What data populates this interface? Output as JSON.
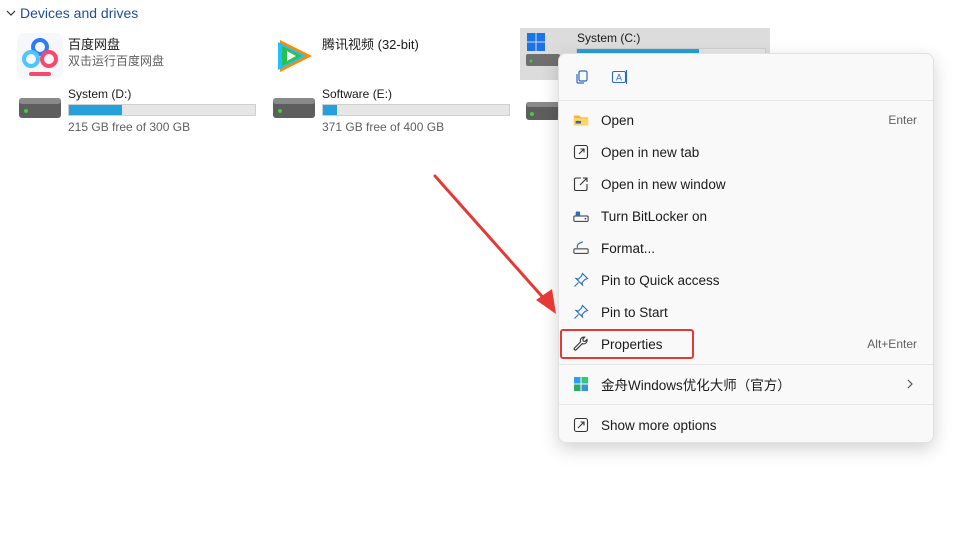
{
  "section": {
    "title": "Devices and drives"
  },
  "tiles": [
    {
      "name": "百度网盘",
      "subtitle": "双击运行百度网盘",
      "icon": "baidu-netdisk-icon"
    },
    {
      "name": "腾讯视频 (32-bit)",
      "icon": "tencent-video-icon"
    },
    {
      "name": "System (C:)",
      "icon": "windows-drive-icon",
      "used_fraction": 0.65
    },
    {
      "name": "System (D:)",
      "free_text": "215 GB free of 300 GB",
      "used_fraction": 0.283,
      "icon": "drive-icon"
    },
    {
      "name": "Software (E:)",
      "free_text": "371 GB free of 400 GB",
      "used_fraction": 0.073,
      "icon": "drive-icon"
    }
  ],
  "context_menu": {
    "top_actions": [
      {
        "icon": "copy-icon"
      },
      {
        "icon": "rename-icon"
      }
    ],
    "items": [
      {
        "label": "Open",
        "shortcut": "Enter",
        "icon": "folder-icon"
      },
      {
        "label": "Open in new tab",
        "icon": "open-new-tab-icon"
      },
      {
        "label": "Open in new window",
        "icon": "open-new-window-icon"
      },
      {
        "label": "Turn BitLocker on",
        "icon": "bitlocker-icon"
      },
      {
        "label": "Format...",
        "icon": "format-icon"
      },
      {
        "label": "Pin to Quick access",
        "icon": "pin-icon"
      },
      {
        "label": "Pin to Start",
        "icon": "pin-icon"
      },
      {
        "label": "Properties",
        "shortcut": "Alt+Enter",
        "icon": "wrench-icon"
      },
      {
        "label": "金舟Windows优化大师（官方）",
        "icon": "app-icon",
        "has_submenu": true
      },
      {
        "label": "Show more options",
        "icon": "more-options-icon"
      }
    ]
  },
  "colors": {
    "accent": "#26a0da",
    "annotation": "#e53935",
    "header": "#1f4e96"
  }
}
